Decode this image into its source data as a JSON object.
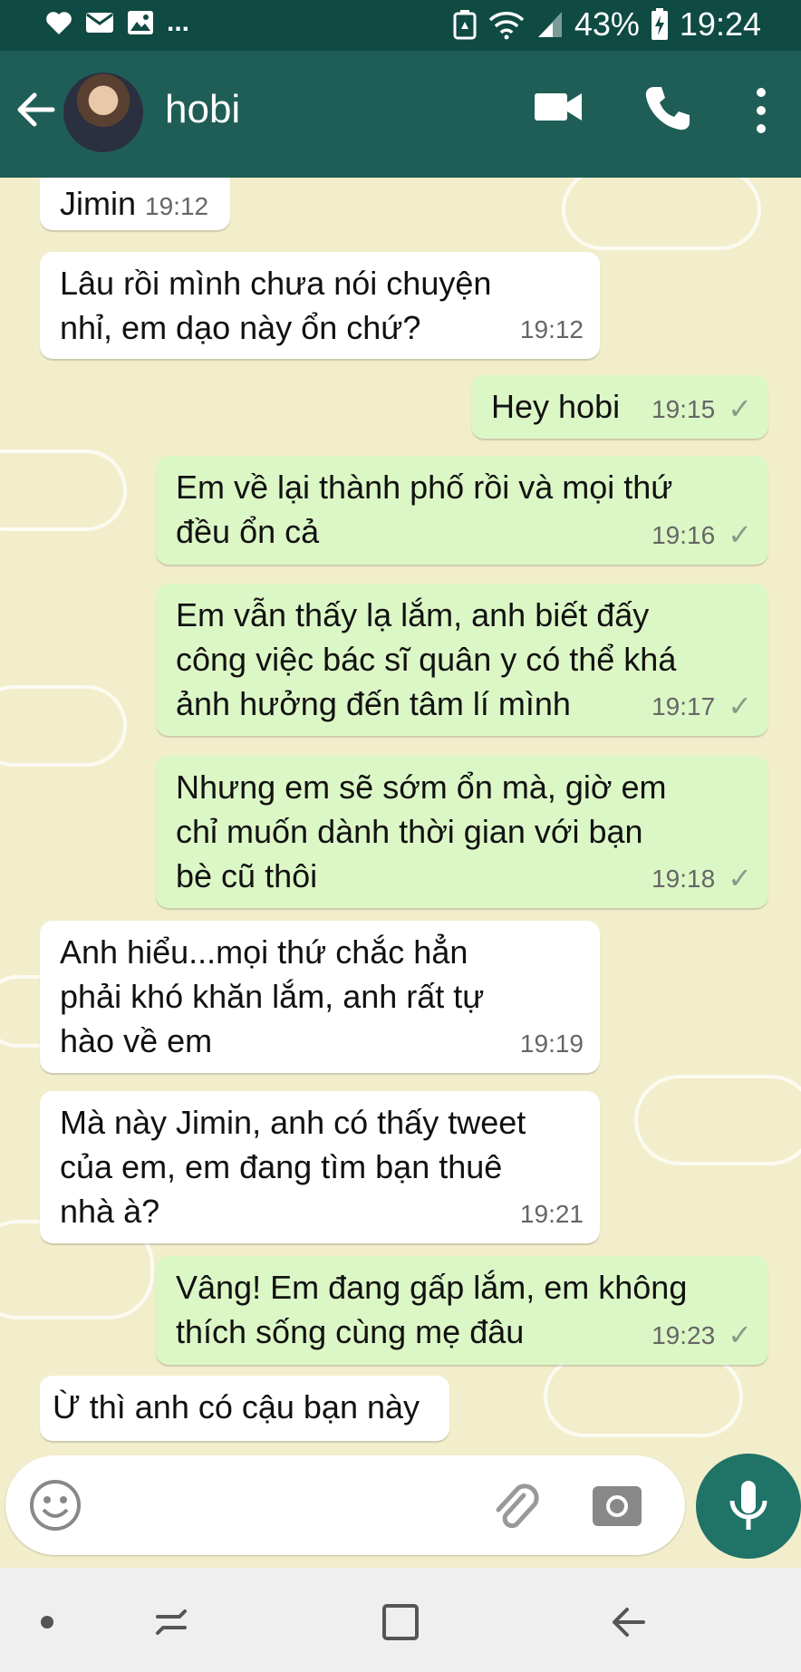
{
  "status_bar": {
    "left_more": "...",
    "battery": "43%",
    "time": "19:24"
  },
  "header": {
    "contact_name": "hobi"
  },
  "messages": [
    {
      "dir": "in",
      "text": "Jimin",
      "time": "19:12"
    },
    {
      "dir": "in",
      "text": "Lâu rồi mình chưa nói chuyện\nnhỉ, em dạo này ổn chứ?",
      "time": "19:12"
    },
    {
      "dir": "out",
      "text": "Hey hobi",
      "time": "19:15"
    },
    {
      "dir": "out",
      "text": "Em về lại thành phố rồi và mọi thứ\nđều ổn cả",
      "time": "19:16"
    },
    {
      "dir": "out",
      "text": "Em vẫn thấy lạ lắm, anh biết đấy\ncông việc bác sĩ quân y có thể khá\nảnh hưởng đến tâm lí mình",
      "time": "19:17"
    },
    {
      "dir": "out",
      "text": "Nhưng em sẽ sớm ổn mà, giờ em\nchỉ muốn dành thời gian với bạn\nbè cũ thôi",
      "time": "19:18"
    },
    {
      "dir": "in",
      "text": "Anh hiểu...mọi thứ chắc hẳn\nphải khó khăn lắm, anh rất tự\nhào về em",
      "time": "19:19"
    },
    {
      "dir": "in",
      "text": "Mà này Jimin, anh có thấy tweet\ncủa em, em đang tìm bạn thuê\nnhà à?",
      "time": "19:21"
    },
    {
      "dir": "out",
      "text": "Vâng! Em đang gấp lắm, em không\nthích sống cùng mẹ đâu",
      "time": "19:23"
    },
    {
      "dir": "in",
      "text": "Ừ thì anh có cậu bạn này",
      "time": ""
    }
  ],
  "read_mark": "✓",
  "colors": {
    "header": "#1f5e56",
    "status_bar": "#0f4a43",
    "chat_background": "#f2eecb",
    "outgoing_bubble": "#dcf7c6",
    "incoming_bubble": "#ffffff",
    "mic_button": "#1f7367"
  },
  "icons": [
    "heart-icon",
    "mail-icon",
    "image-icon",
    "recycle-icon",
    "wifi-icon",
    "signal-icon",
    "battery-icon",
    "back-arrow-icon",
    "video-call-icon",
    "phone-icon",
    "more-vert-icon",
    "emoji-icon",
    "paperclip-icon",
    "camera-icon",
    "mic-icon",
    "nav-dot-icon",
    "recents-icon",
    "home-icon",
    "nav-back-icon"
  ]
}
